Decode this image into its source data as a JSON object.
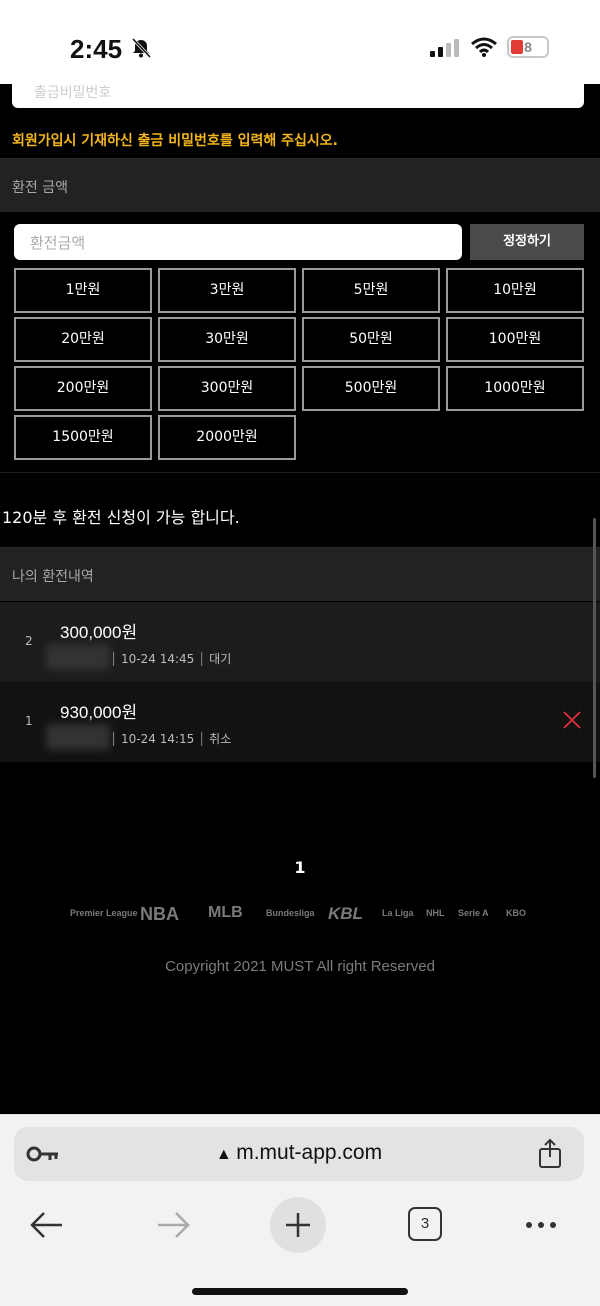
{
  "status_bar": {
    "time": "2:45",
    "battery": "8"
  },
  "form": {
    "top_input_placeholder": "출금비밀번호",
    "notice": "회원가입시 기재하신 출금 비밀번호를 입력해 주십시오.",
    "amount_section_title": "환전 금액",
    "amount_placeholder": "환전금액",
    "reset_label": "정정하기",
    "amount_buttons": [
      "1만원",
      "3만원",
      "5만원",
      "10만원",
      "20만원",
      "30만원",
      "50만원",
      "100만원",
      "200만원",
      "300만원",
      "500만원",
      "1000만원",
      "1500만원",
      "2000만원"
    ],
    "wait_message": "120분 후 환전 신청이 가능 합니다."
  },
  "history": {
    "title": "나의 환전내역",
    "rows": [
      {
        "index": "2",
        "amount": "300,000원",
        "datetime": "10-24 14:45",
        "status": "대기",
        "cancelable": false
      },
      {
        "index": "1",
        "amount": "930,000원",
        "datetime": "10-24 14:15",
        "status": "취소",
        "cancelable": true
      }
    ]
  },
  "pagination": {
    "current": "1"
  },
  "footer": {
    "logos": [
      "Premier League",
      "NBA",
      "MLB",
      "Bundesliga",
      "KBL",
      "La Liga",
      "NHL",
      "Serie A",
      "KBO"
    ],
    "copyright": "Copyright 2021 MUST All right Reserved"
  },
  "browser": {
    "url": "m.mut-app.com",
    "tab_count": "3"
  },
  "colors": {
    "accent_notice": "#f3b51c",
    "cancel_x": "#e0313c",
    "background": "#000000"
  }
}
